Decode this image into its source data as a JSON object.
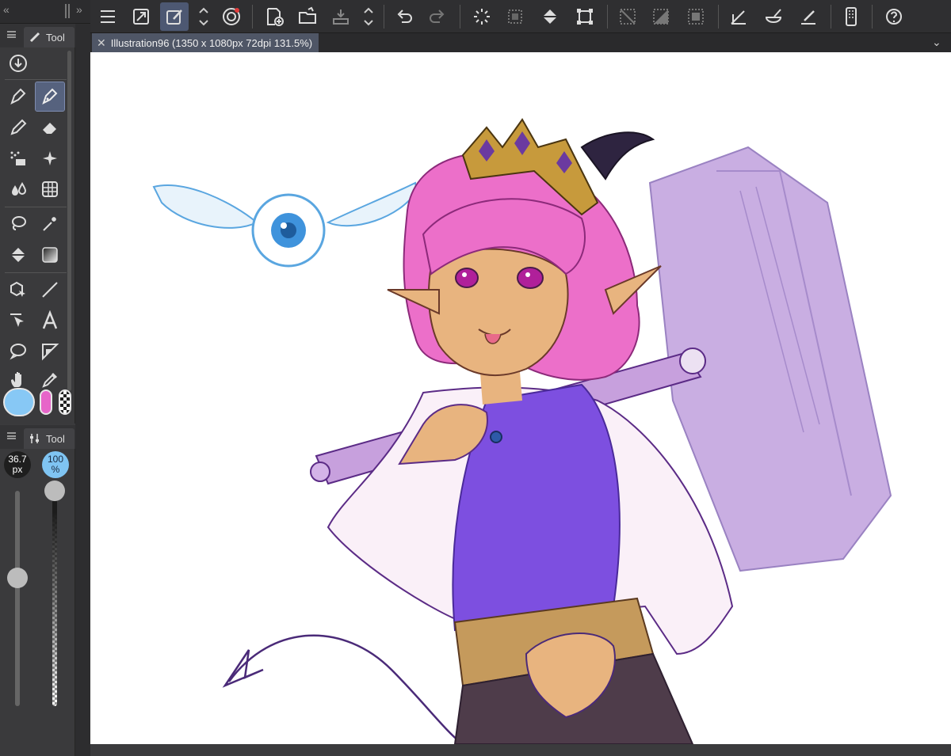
{
  "app": {
    "document_tab": {
      "title": "Illustration96 (1350 x 1080px 72dpi 131.5%)"
    }
  },
  "left_panel": {
    "tool_tab_label": "Tool",
    "property_tab_label": "Tool",
    "brush_size": {
      "value": "36.7",
      "unit": "px"
    },
    "brush_opacity": {
      "value": "100",
      "unit": "%"
    }
  },
  "icons": {
    "collapse_left": "«",
    "collapse_right": "»",
    "tab_menu": "⌄",
    "close_tab": "✕"
  },
  "colors": {
    "main_color": "#87c8f5",
    "sub_color": "#e765c9"
  }
}
